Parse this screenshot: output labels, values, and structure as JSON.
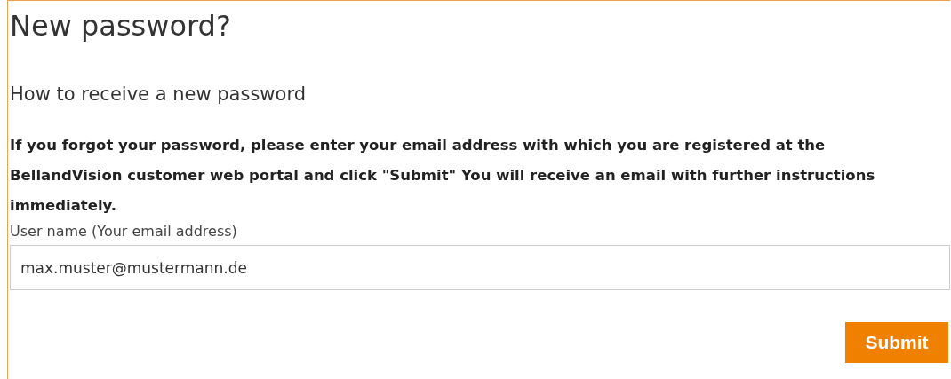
{
  "page": {
    "title": "New password?",
    "subtitle": "How to receive a new password",
    "instructions": "If you forgot your password, please enter your email address with which you are registered at the BellandVision customer web portal and click \"Submit\" You will receive an email with further instructions immediately."
  },
  "form": {
    "label": "User name (Your email address)",
    "value": "max.muster@mustermann.de",
    "submit": "Submit"
  }
}
